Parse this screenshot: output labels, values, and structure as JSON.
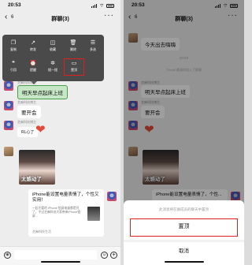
{
  "status": {
    "time": "20:53"
  },
  "chat": {
    "title": "群聊(3)",
    "unread": "6",
    "more": "···"
  },
  "menu": {
    "items": [
      {
        "label": "复制",
        "icon": "copy-icon",
        "glyph": "❐"
      },
      {
        "label": "转发",
        "icon": "forward-icon",
        "glyph": "↗"
      },
      {
        "label": "收藏",
        "icon": "collect-icon",
        "glyph": "◫"
      },
      {
        "label": "删除",
        "icon": "delete-icon",
        "glyph": "🗑"
      },
      {
        "label": "多选",
        "icon": "multiselect-icon",
        "glyph": "☰"
      },
      {
        "label": "引用",
        "icon": "quote-icon",
        "glyph": "❝"
      },
      {
        "label": "提醒",
        "icon": "remind-icon",
        "glyph": "⏰"
      },
      {
        "label": "搜一搜",
        "icon": "search-icon",
        "glyph": "✲"
      },
      {
        "label": "置顶",
        "icon": "pin-icon",
        "glyph": "▭"
      }
    ]
  },
  "messages": {
    "sender": "芝麻科技博主",
    "highlighted": "明天早点起床上班",
    "meeting": "要开会",
    "sticker_text": "RL心了",
    "gif_caption": "太感动了",
    "card_title": "iPhone能设置电量表情了，个性又实用！",
    "card_desc": "一起不要的 iPhone 锁屏电量都是死了，不过芝麻科技大家带来iPhone锁屏...",
    "card_source": "芝麻科技生活"
  },
  "right": {
    "top_message": "今天出去嗨嗨",
    "timestamp": "20:53",
    "system_message": "\"Redis\"邀请你加入了群聊",
    "highlighted": "明天早点起床上班",
    "meeting": "要开会",
    "card_title": "iPhone能设置电量表情了，个性...",
    "sheet_hint": "此消息将在群成员的聊天中置顶",
    "pin_label": "置顶",
    "cancel_label": "取消"
  },
  "colors": {
    "accent_red": "#e02020",
    "bubble_green": "#c6e6c6",
    "heart": "#e04a3a"
  }
}
